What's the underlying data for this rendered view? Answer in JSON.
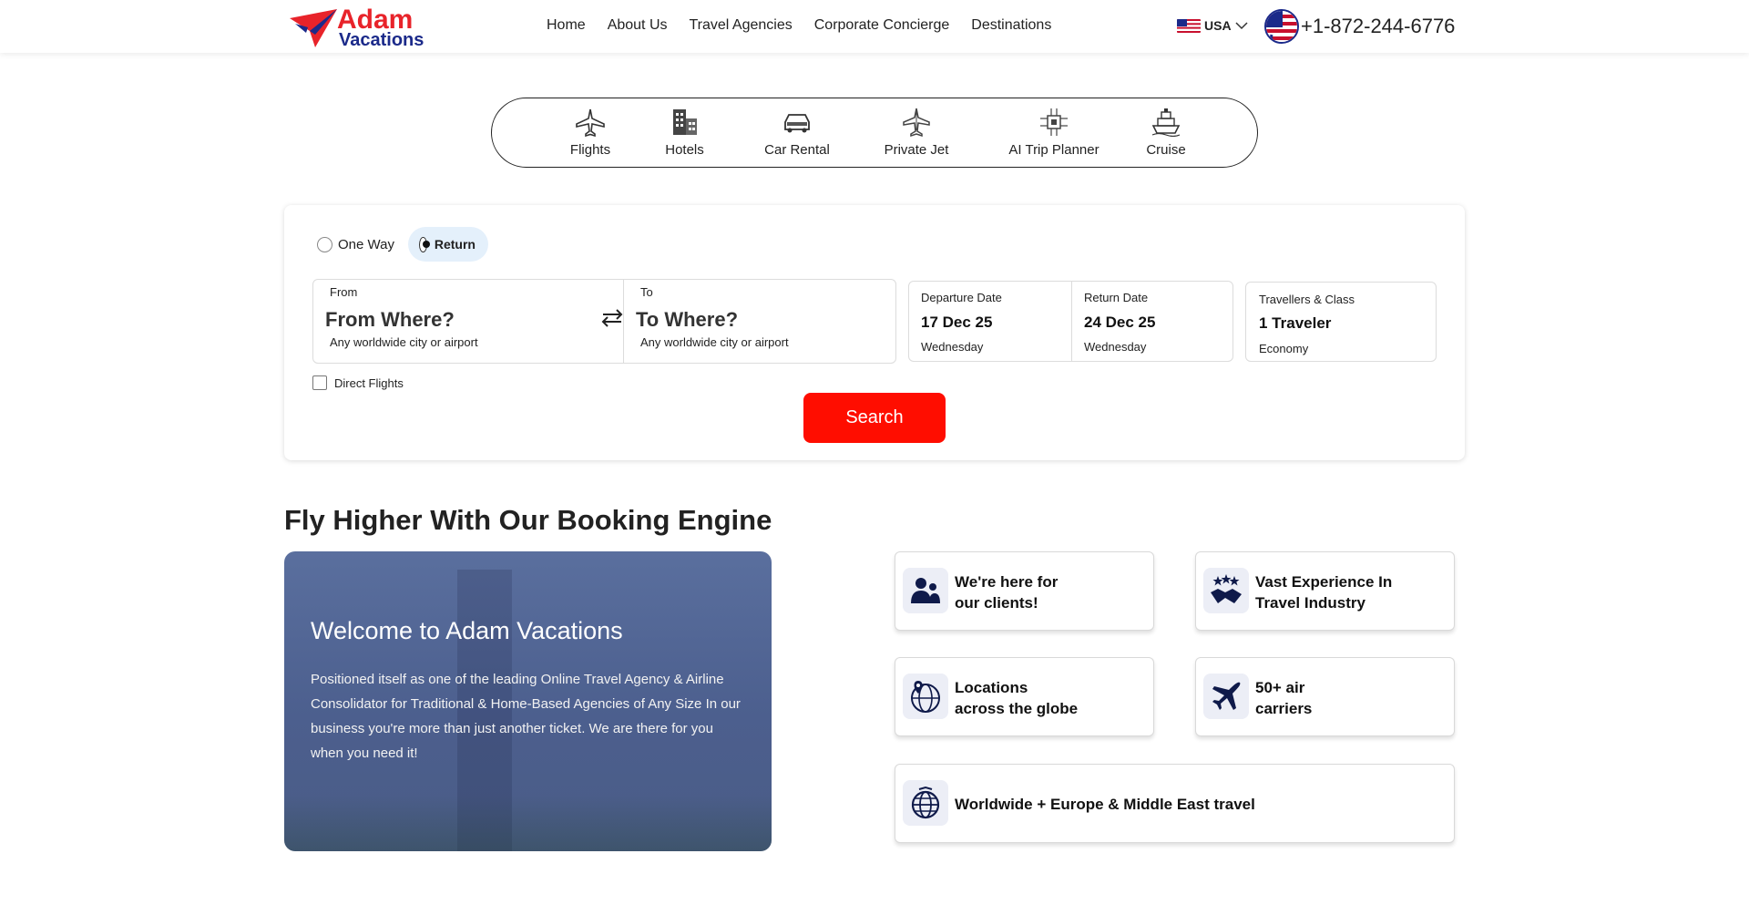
{
  "header": {
    "logo_line1": "Adam",
    "logo_line2": "Vacations",
    "nav": [
      "Home",
      "About Us",
      "Travel Agencies",
      "Corporate Concierge",
      "Destinations"
    ],
    "country": "USA",
    "phone": "+1-872-244-6776"
  },
  "tabs": [
    {
      "label": "Flights",
      "icon": "plane-icon"
    },
    {
      "label": "Hotels",
      "icon": "hotel-icon"
    },
    {
      "label": "Car Rental",
      "icon": "car-icon"
    },
    {
      "label": "Private Jet",
      "icon": "jet-icon"
    },
    {
      "label": "AI Trip Planner",
      "icon": "ai-chip-icon"
    },
    {
      "label": "Cruise",
      "icon": "cruise-icon"
    }
  ],
  "search": {
    "one_way": "One Way",
    "return": "Return",
    "selected_trip": "Return",
    "from_label": "From",
    "from_placeholder": "From Where?",
    "from_hint": "Any worldwide city or airport",
    "to_label": "To",
    "to_placeholder": "To Where?",
    "to_hint": "Any worldwide city or airport",
    "departure_label": "Departure Date",
    "departure_date": "17 Dec 25",
    "departure_day": "Wednesday",
    "return_label": "Return Date",
    "return_date": "24 Dec 25",
    "return_day": "Wednesday",
    "travellers_label": "Travellers & Class",
    "travellers_value": "1 Traveler",
    "travellers_class": "Economy",
    "direct_flights": "Direct Flights",
    "search_button": "Search"
  },
  "section": {
    "title": "Fly Higher With Our Booking Engine",
    "welcome_title": "Welcome to Adam Vacations",
    "welcome_text": "Positioned itself as one of the leading Online Travel Agency & Airline Consolidator for Traditional & Home-Based Agencies of Any Size In our business you're more than just another ticket. We are there for you when you need it!"
  },
  "features": [
    {
      "line1": "We're here for",
      "line2": "our clients!",
      "icon": "clients-icon"
    },
    {
      "line1": "Vast Experience In",
      "line2": "Travel Industry",
      "icon": "handshake-icon"
    },
    {
      "line1": "Locations",
      "line2": "across the globe",
      "icon": "globe-location-icon"
    },
    {
      "line1": "50+ air",
      "line2": "carriers",
      "icon": "airplane-icon"
    },
    {
      "line1": "Worldwide + Europe & Middle East travel",
      "icon": "globe-icon"
    }
  ],
  "colors": {
    "brand_red": "#e8232a",
    "brand_navy": "#1b2a8a",
    "search_button": "#ff0d00",
    "icon_navy": "#0f1a4a"
  }
}
